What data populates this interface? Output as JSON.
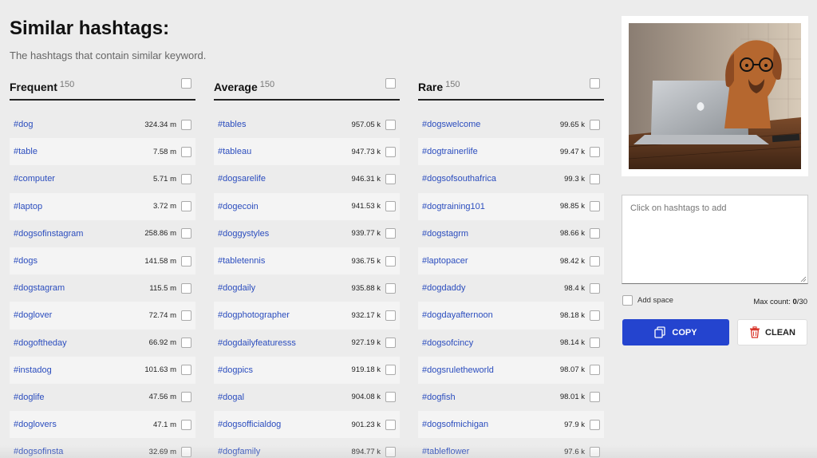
{
  "page": {
    "title": "Similar hashtags:",
    "subtitle": "The hashtags that contain similar keyword."
  },
  "columns": [
    {
      "name": "Frequent",
      "count": "150",
      "rows": [
        {
          "tag": "#dog",
          "count": "324.34 m"
        },
        {
          "tag": "#table",
          "count": "7.58 m"
        },
        {
          "tag": "#computer",
          "count": "5.71 m"
        },
        {
          "tag": "#laptop",
          "count": "3.72 m"
        },
        {
          "tag": "#dogsofinstagram",
          "count": "258.86 m"
        },
        {
          "tag": "#dogs",
          "count": "141.58 m"
        },
        {
          "tag": "#dogstagram",
          "count": "115.5 m"
        },
        {
          "tag": "#doglover",
          "count": "72.74 m"
        },
        {
          "tag": "#dogoftheday",
          "count": "66.92 m"
        },
        {
          "tag": "#instadog",
          "count": "101.63 m"
        },
        {
          "tag": "#doglife",
          "count": "47.56 m"
        },
        {
          "tag": "#doglovers",
          "count": "47.1 m"
        },
        {
          "tag": "#dogsofinsta",
          "count": "32.69 m"
        }
      ]
    },
    {
      "name": "Average",
      "count": "150",
      "rows": [
        {
          "tag": "#tables",
          "count": "957.05 k"
        },
        {
          "tag": "#tableau",
          "count": "947.73 k"
        },
        {
          "tag": "#dogsarelife",
          "count": "946.31 k"
        },
        {
          "tag": "#dogecoin",
          "count": "941.53 k"
        },
        {
          "tag": "#doggystyles",
          "count": "939.77 k"
        },
        {
          "tag": "#tabletennis",
          "count": "936.75 k"
        },
        {
          "tag": "#dogdaily",
          "count": "935.88 k"
        },
        {
          "tag": "#dogphotographer",
          "count": "932.17 k"
        },
        {
          "tag": "#dogdailyfeaturesss",
          "count": "927.19 k"
        },
        {
          "tag": "#dogpics",
          "count": "919.18 k"
        },
        {
          "tag": "#dogal",
          "count": "904.08 k"
        },
        {
          "tag": "#dogsofficialdog",
          "count": "901.23 k"
        },
        {
          "tag": "#dogfamily",
          "count": "894.77 k"
        }
      ]
    },
    {
      "name": "Rare",
      "count": "150",
      "rows": [
        {
          "tag": "#dogswelcome",
          "count": "99.65 k"
        },
        {
          "tag": "#dogtrainerlife",
          "count": "99.47 k"
        },
        {
          "tag": "#dogsofsouthafrica",
          "count": "99.3 k"
        },
        {
          "tag": "#dogtraining101",
          "count": "98.85 k"
        },
        {
          "tag": "#dogstagrm",
          "count": "98.66 k"
        },
        {
          "tag": "#laptopacer",
          "count": "98.42 k"
        },
        {
          "tag": "#dogdaddy",
          "count": "98.4 k"
        },
        {
          "tag": "#dogdayafternoon",
          "count": "98.18 k"
        },
        {
          "tag": "#dogsofcincy",
          "count": "98.14 k"
        },
        {
          "tag": "#dogsruletheworld",
          "count": "98.07 k"
        },
        {
          "tag": "#dogfish",
          "count": "98.01 k"
        },
        {
          "tag": "#dogsofmichigan",
          "count": "97.9 k"
        },
        {
          "tag": "#tableflower",
          "count": "97.6 k"
        }
      ]
    }
  ],
  "panel": {
    "placeholder": "Click on hashtags to add",
    "add_space_label": "Add space",
    "max_count_label": "Max count:",
    "max_count_current": "0",
    "max_count_total": "/30",
    "copy_label": "COPY",
    "clean_label": "CLEAN",
    "copy_icon": "copy-icon",
    "clean_icon": "trash-icon"
  },
  "colors": {
    "accent": "#2444cf",
    "link": "#2b4dbe",
    "danger": "#d9362b"
  }
}
